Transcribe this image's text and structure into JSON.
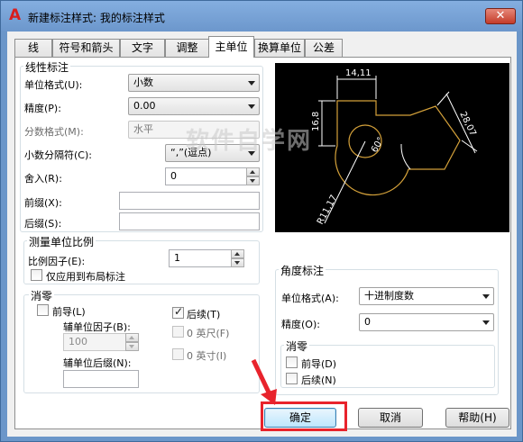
{
  "window": {
    "title": "新建标注样式: 我的标注样式",
    "app_icon": "A",
    "close_label": "✕"
  },
  "tabs": [
    {
      "label": "线",
      "active": false
    },
    {
      "label": "符号和箭头",
      "active": false
    },
    {
      "label": "文字",
      "active": false
    },
    {
      "label": "调整",
      "active": false
    },
    {
      "label": "主单位",
      "active": true
    },
    {
      "label": "换算单位",
      "active": false
    },
    {
      "label": "公差",
      "active": false
    }
  ],
  "linear": {
    "group_title": "线性标注",
    "unit_format_label": "单位格式(U):",
    "unit_format_value": "小数",
    "precision_label": "精度(P):",
    "precision_value": "0.00",
    "fraction_format_label": "分数格式(M):",
    "fraction_format_value": "水平",
    "decimal_separator_label": "小数分隔符(C):",
    "decimal_separator_value": "“,”(逗点)",
    "round_off_label": "舍入(R):",
    "round_off_value": "0",
    "prefix_label": "前缀(X):",
    "prefix_value": "",
    "suffix_label": "后缀(S):",
    "suffix_value": ""
  },
  "scale": {
    "group_title": "测量单位比例",
    "factor_label": "比例因子(E):",
    "factor_value": "1",
    "layout_only_label": "仅应用到布局标注",
    "layout_only_checked": false
  },
  "zero_linear": {
    "group_title": "消零",
    "leading_label": "前导(L)",
    "leading_checked": false,
    "trailing_label": "后续(T)",
    "trailing_checked": true,
    "sub_unit_factor_label": "辅单位因子(B):",
    "sub_unit_factor_value": "100",
    "sub_unit_suffix_label": "辅单位后缀(N):",
    "sub_unit_suffix_value": "",
    "feet_label": "0 英尺(F)",
    "inches_label": "0 英寸(I)"
  },
  "preview": {
    "dim_top": "14,11",
    "dim_left": "16,8",
    "dim_right": "28,07",
    "dim_angle": "60°",
    "dim_radius": "R11,17",
    "watermark": "软件自学网"
  },
  "angular": {
    "group_title": "角度标注",
    "unit_format_label": "单位格式(A):",
    "unit_format_value": "十进制度数",
    "precision_label": "精度(O):",
    "precision_value": "0",
    "zero_group_title": "消零",
    "leading_label": "前导(D)",
    "leading_checked": false,
    "trailing_label": "后续(N)",
    "trailing_checked": false
  },
  "buttons": {
    "ok": "确定",
    "cancel": "取消",
    "help": "帮助(H)"
  },
  "colors": {
    "title_bar": "#6b96c9",
    "close_button": "#c43c2a",
    "preview_background": "#000000",
    "preview_lines": "#d4a13a",
    "annotation": "#e8232c"
  }
}
